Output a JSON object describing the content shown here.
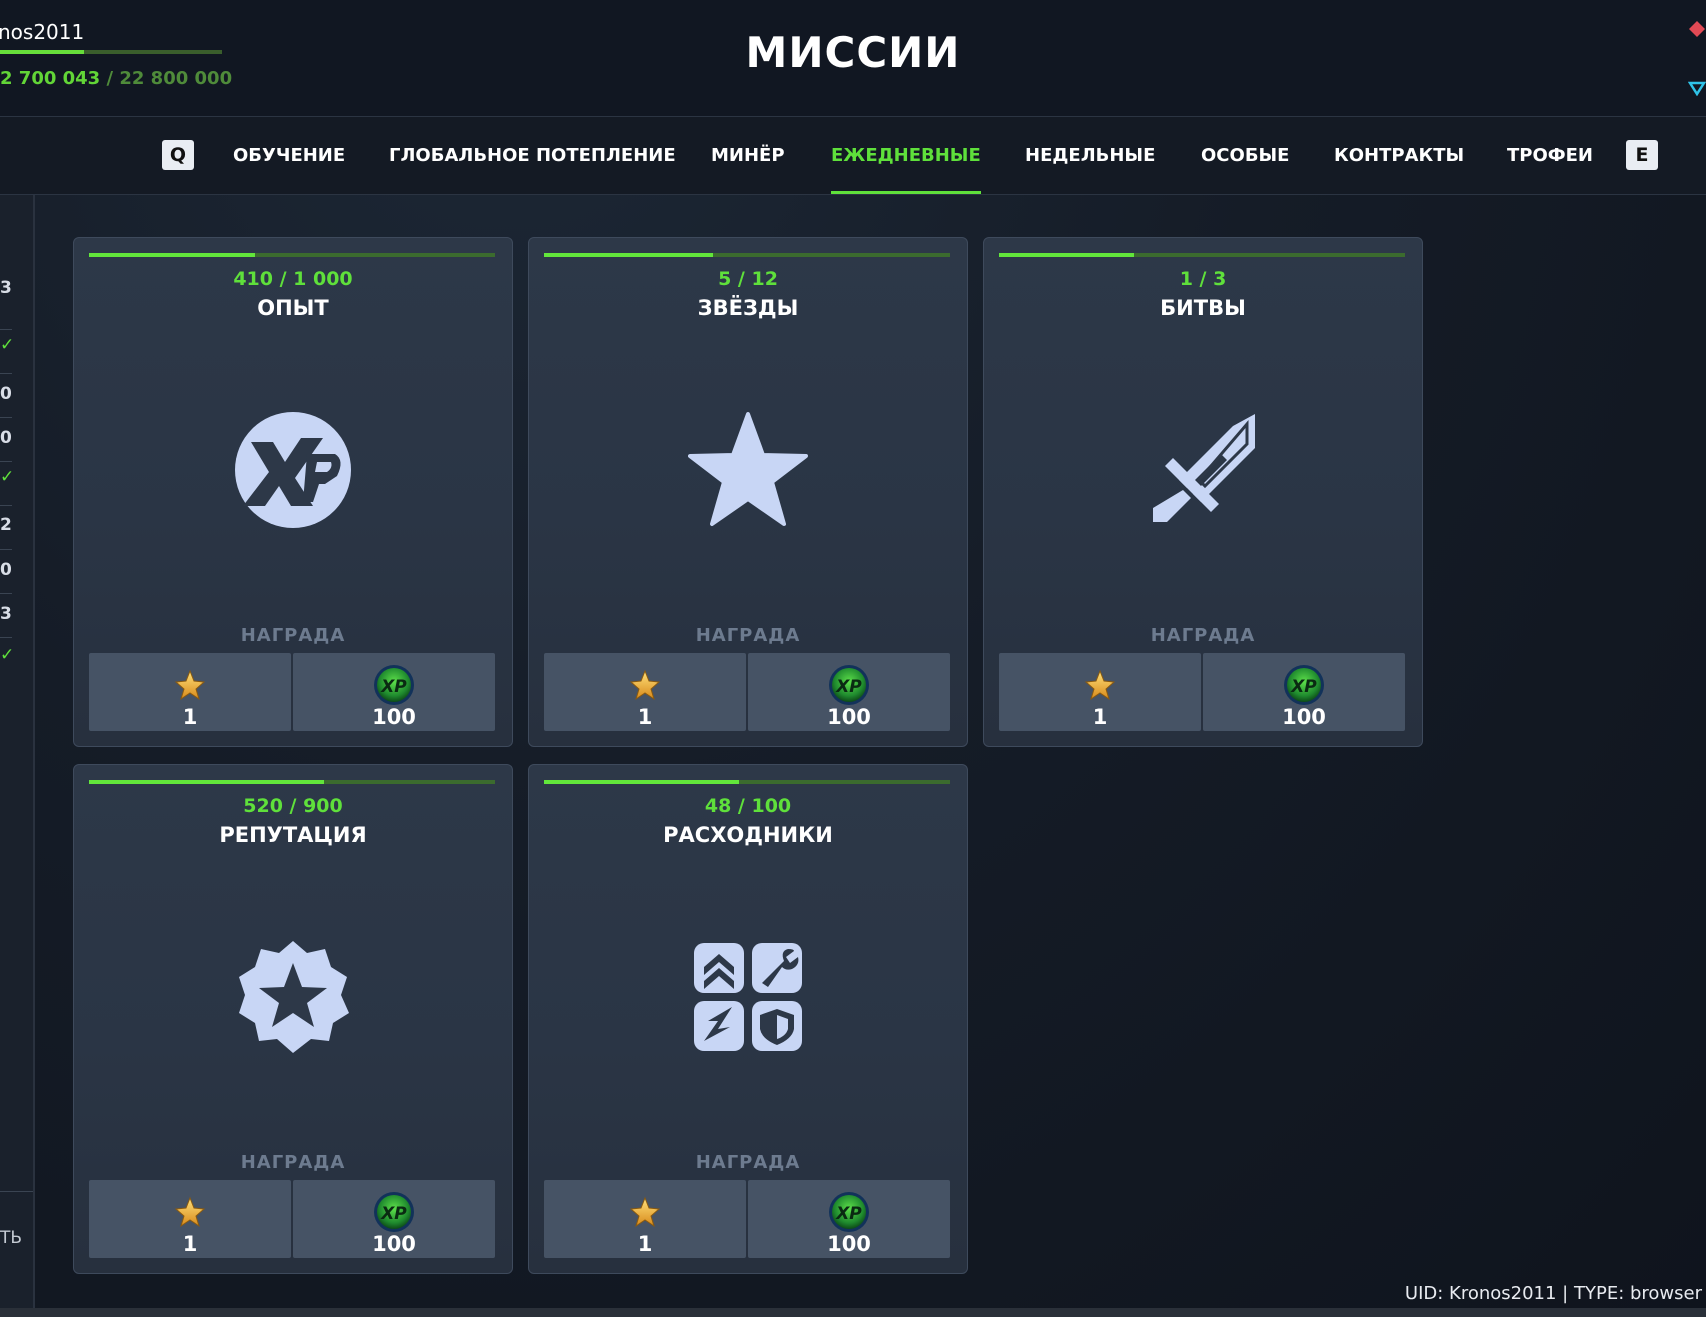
{
  "player": {
    "name": "nos2011",
    "xp_current": "2 700 043",
    "xp_separator": "/",
    "xp_max": "22 800 000",
    "xp_fraction": 0.38
  },
  "page_title": "МИССИИ",
  "tabs": {
    "key_prev": "Q",
    "key_next": "E",
    "items": [
      "ОБУЧЕНИЕ",
      "ГЛОБАЛЬНОЕ ПОТЕПЛЕНИЕ",
      "МИНЁР",
      "ЕЖЕДНЕВНЫЕ",
      "НЕДЕЛЬНЫЕ",
      "ОСОБЫЕ",
      "КОНТРАКТЫ",
      "ТРОФЕИ"
    ],
    "active": "ЕЖЕДНЕВНЫЕ"
  },
  "left_panel": {
    "items": [
      "3",
      "✓",
      "0",
      "0",
      "✓",
      "2",
      "0",
      "3",
      "✓"
    ],
    "bottom_label": "ТЬ"
  },
  "reward_label": "НАГРАДА",
  "missions": [
    {
      "name": "ОПЫТ",
      "progress": "410 / 1 000",
      "fraction": 0.41,
      "icon": "xp-icon",
      "rewards": [
        "1",
        "100"
      ]
    },
    {
      "name": "ЗВЁЗДЫ",
      "progress": "5 / 12",
      "fraction": 0.4167,
      "icon": "star-icon",
      "rewards": [
        "1",
        "100"
      ]
    },
    {
      "name": "БИТВЫ",
      "progress": "1 / 3",
      "fraction": 0.3333,
      "icon": "sword-icon",
      "rewards": [
        "1",
        "100"
      ]
    },
    {
      "name": "РЕПУТАЦИЯ",
      "progress": "520 / 900",
      "fraction": 0.5778,
      "icon": "reputation-badge-icon",
      "rewards": [
        "1",
        "100"
      ]
    },
    {
      "name": "РАСХОДНИКИ",
      "progress": "48 / 100",
      "fraction": 0.48,
      "icon": "consumables-icon",
      "rewards": [
        "1",
        "100"
      ]
    }
  ],
  "footer": "UID: Kronos2011 | TYPE: browser",
  "colors": {
    "accent": "#5fe03b",
    "card_bg": "#2d3848",
    "reward_box": "#465365",
    "icon_fill": "#c8d6f5"
  }
}
